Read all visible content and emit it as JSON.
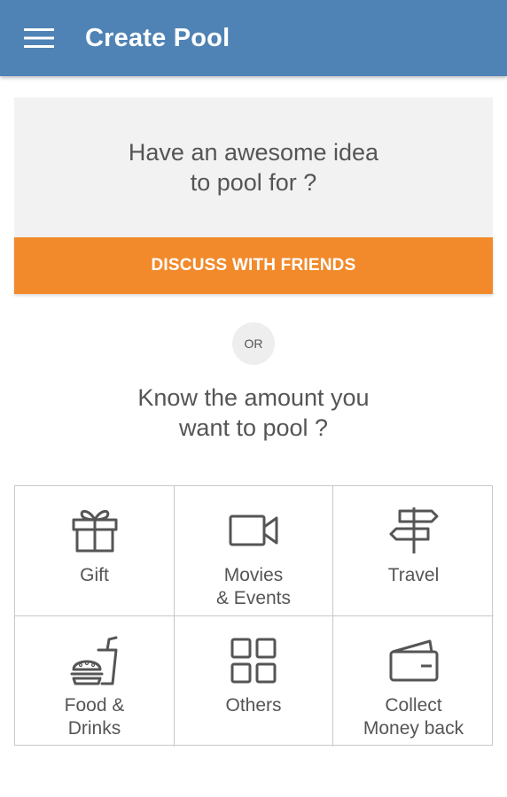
{
  "appbar": {
    "title": "Create Pool",
    "menu_icon": "hamburger-menu-icon",
    "color": "#4f83b5"
  },
  "idea": {
    "line1": "Have an awesome idea",
    "line2": "to pool for ?",
    "button_label": "DISCUSS WITH FRIENDS",
    "button_color": "#f28a2b"
  },
  "divider": {
    "or_label": "OR"
  },
  "know": {
    "line1": "Know the amount you",
    "line2": "want to pool ?"
  },
  "categories": [
    {
      "line1": "Gift",
      "line2": "",
      "icon": "gift-icon"
    },
    {
      "line1": "Movies",
      "line2": "& Events",
      "icon": "video-camera-icon"
    },
    {
      "line1": "Travel",
      "line2": "",
      "icon": "signpost-icon"
    },
    {
      "line1": "Food &",
      "line2": "Drinks",
      "icon": "burger-drink-icon"
    },
    {
      "line1": "Others",
      "line2": "",
      "icon": "grid-icon"
    },
    {
      "line1": "Collect",
      "line2": "Money back",
      "icon": "wallet-icon"
    }
  ]
}
